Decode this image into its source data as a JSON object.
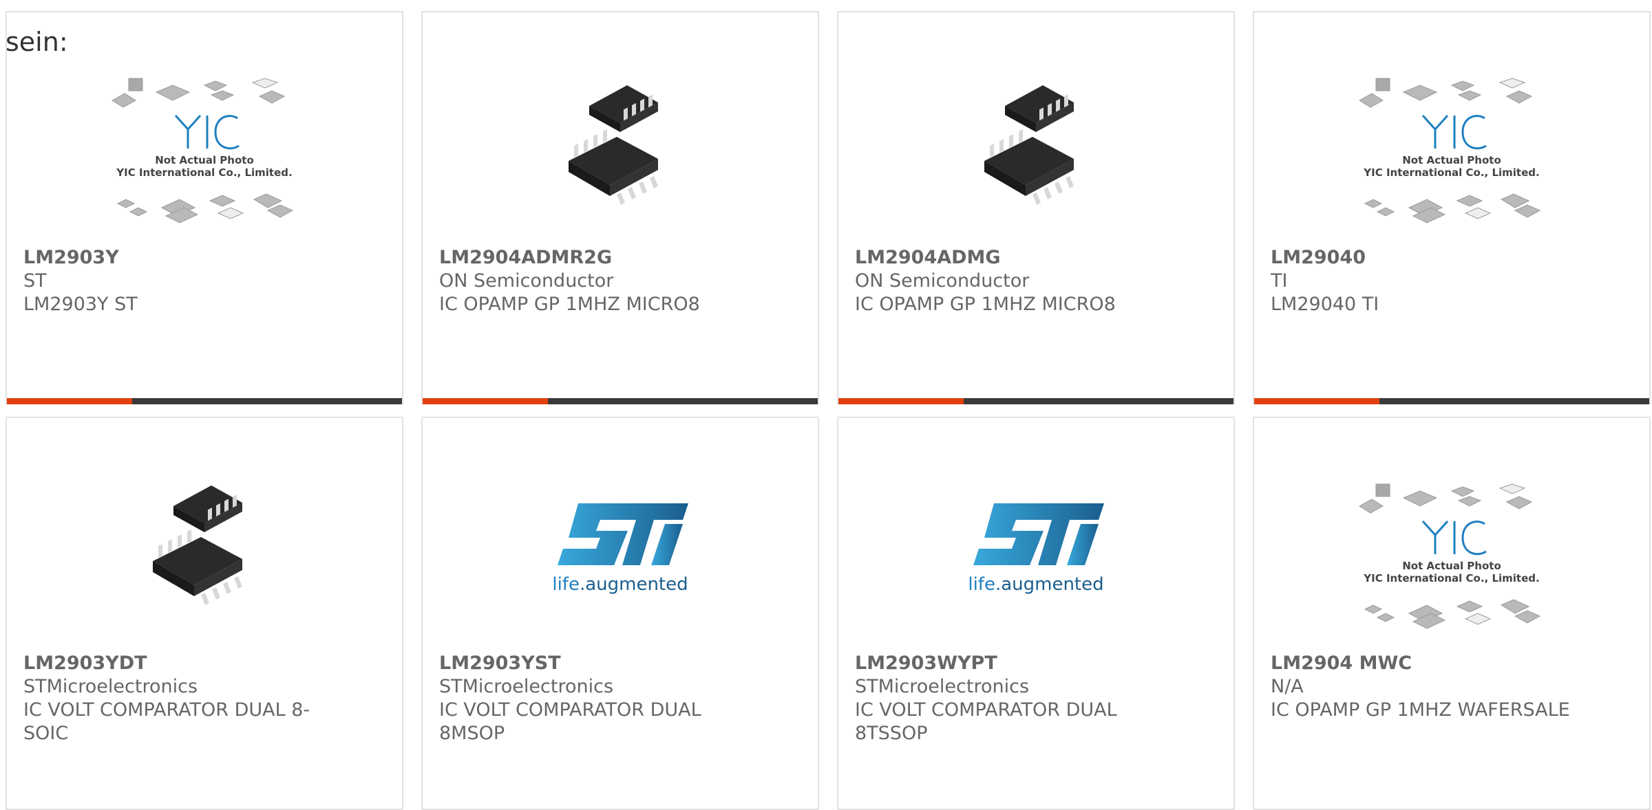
{
  "intro": "sein:",
  "colors": {
    "accent": "#e2410f",
    "bar": "#3a3a3a",
    "text": "#666666",
    "border": "#e2e2e2",
    "st_blue": "#1e7fc0"
  },
  "placeholder": {
    "line1": "Not Actual Photo",
    "line2": "YIC International Co., Limited.",
    "logo": "YIC"
  },
  "st_logo": {
    "tagline_part1": "life",
    "tagline_part2": ".augmented"
  },
  "products": [
    {
      "part": "LM2903Y",
      "manufacturer": "ST",
      "description": "LM2903Y ST",
      "image": "placeholder"
    },
    {
      "part": "LM2904ADMR2G",
      "manufacturer": "ON Semiconductor",
      "description": "IC OPAMP GP 1MHZ MICRO8",
      "image": "chip"
    },
    {
      "part": "LM2904ADMG",
      "manufacturer": "ON Semiconductor",
      "description": "IC OPAMP GP 1MHZ MICRO8",
      "image": "chip"
    },
    {
      "part": "LM29040",
      "manufacturer": "TI",
      "description": "LM29040 TI",
      "image": "placeholder"
    },
    {
      "part": "LM2903YDT",
      "manufacturer": "STMicroelectronics",
      "description": "IC VOLT COMPARATOR DUAL 8-SOIC",
      "image": "chip"
    },
    {
      "part": "LM2903YST",
      "manufacturer": "STMicroelectronics",
      "description": "IC VOLT COMPARATOR DUAL 8MSOP",
      "image": "st-logo"
    },
    {
      "part": "LM2903WYPT",
      "manufacturer": "STMicroelectronics",
      "description": "IC VOLT COMPARATOR DUAL 8TSSOP",
      "image": "st-logo"
    },
    {
      "part": "LM2904 MWC",
      "manufacturer": "N/A",
      "description": "IC OPAMP GP 1MHZ WAFERSALE",
      "image": "placeholder"
    }
  ]
}
